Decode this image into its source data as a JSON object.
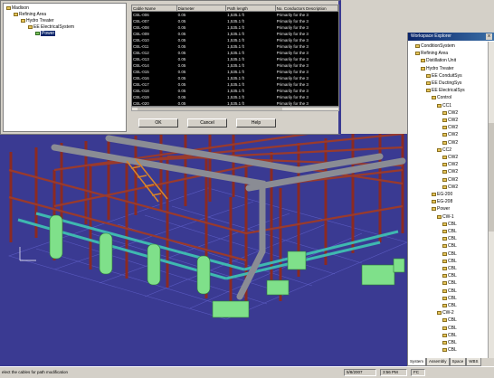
{
  "dialog": {
    "tree": [
      {
        "label": "Madison",
        "level": 0
      },
      {
        "label": "Refining Area",
        "level": 1
      },
      {
        "label": "Hydro Treater",
        "level": 2
      },
      {
        "label": "EE ElectricalSystem",
        "level": 3
      },
      {
        "label": "Power",
        "level": 4,
        "selected": true
      }
    ],
    "columns": [
      "Cable Name",
      "Diameter",
      "Path length",
      "No. Conductors Description"
    ],
    "rows": [
      [
        "CBL-006",
        "0.05",
        "1,535.1 ft",
        "Primarily for the 3"
      ],
      [
        "CBL-007",
        "0.05",
        "1,535.1 ft",
        "Primarily for the 3"
      ],
      [
        "CBL-008",
        "0.05",
        "1,535.1 ft",
        "Primarily for the 3"
      ],
      [
        "CBL-009",
        "0.05",
        "1,535.1 ft",
        "Primarily for the 3"
      ],
      [
        "CBL-010",
        "0.05",
        "1,535.1 ft",
        "Primarily for the 3"
      ],
      [
        "CBL-011",
        "0.05",
        "1,535.1 ft",
        "Primarily for the 3"
      ],
      [
        "CBL-012",
        "0.05",
        "1,535.1 ft",
        "Primarily for the 3"
      ],
      [
        "CBL-013",
        "0.05",
        "1,535.1 ft",
        "Primarily for the 3"
      ],
      [
        "CBL-014",
        "0.05",
        "1,535.1 ft",
        "Primarily for the 3"
      ],
      [
        "CBL-015",
        "0.05",
        "1,535.1 ft",
        "Primarily for the 3"
      ],
      [
        "CBL-016",
        "0.05",
        "1,535.1 ft",
        "Primarily for the 3"
      ],
      [
        "CBL-017",
        "0.05",
        "1,535.1 ft",
        "Primarily for the 3"
      ],
      [
        "CBL-018",
        "0.05",
        "1,535.1 ft",
        "Primarily for the 3"
      ],
      [
        "CBL-019",
        "0.05",
        "1,535.1 ft",
        "Primarily for the 3"
      ],
      [
        "CBL-020",
        "0.05",
        "1,535.1 ft",
        "Primarily for the 3"
      ]
    ],
    "ok_label": "OK",
    "cancel_label": "Cancel",
    "help_label": "Help"
  },
  "spec": {
    "title": "Workspace Explorer",
    "close": "x",
    "tree": [
      {
        "label": "ConditionSystem",
        "level": 1
      },
      {
        "label": "Refining Area",
        "level": 1
      },
      {
        "label": "Distillation Unit",
        "level": 2
      },
      {
        "label": "Hydro Treater",
        "level": 2
      },
      {
        "label": "EE ConduitSys",
        "level": 3
      },
      {
        "label": "EE DuctingSys",
        "level": 3
      },
      {
        "label": "EE ElectricalSys",
        "level": 3
      },
      {
        "label": "Control",
        "level": 4
      },
      {
        "label": "CC1",
        "level": 5
      },
      {
        "label": "CW2",
        "level": 6
      },
      {
        "label": "CW2",
        "level": 6
      },
      {
        "label": "CW2",
        "level": 6
      },
      {
        "label": "CW2",
        "level": 6
      },
      {
        "label": "CW2",
        "level": 6
      },
      {
        "label": "CC2",
        "level": 5
      },
      {
        "label": "CW2",
        "level": 6
      },
      {
        "label": "CW2",
        "level": 6
      },
      {
        "label": "CW2",
        "level": 6
      },
      {
        "label": "CW2",
        "level": 6
      },
      {
        "label": "CW2",
        "level": 6
      },
      {
        "label": "EG-200",
        "level": 4
      },
      {
        "label": "EG-208",
        "level": 4
      },
      {
        "label": "Power",
        "level": 4
      },
      {
        "label": "CW-1",
        "level": 5
      },
      {
        "label": "CBL",
        "level": 6
      },
      {
        "label": "CBL",
        "level": 6
      },
      {
        "label": "CBL",
        "level": 6
      },
      {
        "label": "CBL",
        "level": 6
      },
      {
        "label": "CBL",
        "level": 6
      },
      {
        "label": "CBL",
        "level": 6
      },
      {
        "label": "CBL",
        "level": 6
      },
      {
        "label": "CBL",
        "level": 6
      },
      {
        "label": "CBL",
        "level": 6
      },
      {
        "label": "CBL",
        "level": 6
      },
      {
        "label": "CBL",
        "level": 6
      },
      {
        "label": "CBL",
        "level": 6
      },
      {
        "label": "CW-2",
        "level": 5
      },
      {
        "label": "CBL",
        "level": 6
      },
      {
        "label": "CBL",
        "level": 6
      },
      {
        "label": "CBL",
        "level": 6
      },
      {
        "label": "CBL",
        "level": 6
      },
      {
        "label": "CBL",
        "level": 6
      }
    ]
  },
  "tabs": [
    "System",
    "Assembly",
    "Space",
    "WBS"
  ],
  "status": {
    "message": "elect the cables for path modification",
    "date": "5/8/2007",
    "time": "3:56 PM",
    "flag": "FC"
  },
  "colors": {
    "viewport_bg": "#3a3a92",
    "steel_red": "#8b2a22",
    "pipe_grey": "#8a8c94",
    "tray_cyan": "#3fb8b0",
    "equipment_green": "#7fe08a"
  }
}
